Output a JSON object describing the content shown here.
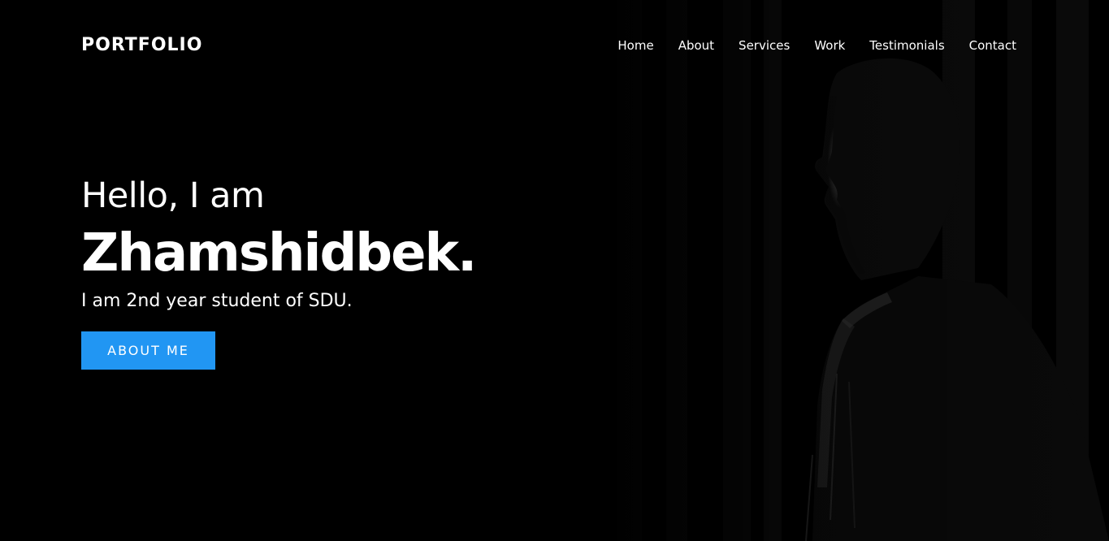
{
  "navbar": {
    "logo": "PORTFOLIO",
    "items": [
      {
        "label": "Home"
      },
      {
        "label": "About"
      },
      {
        "label": "Services"
      },
      {
        "label": "Work"
      },
      {
        "label": "Testimonials"
      },
      {
        "label": "Contact"
      }
    ]
  },
  "hero": {
    "greeting": "Hello, I am",
    "name": "Zhamshidbek.",
    "tagline": "I am 2nd year student of SDU.",
    "button_label": "ABOUT ME",
    "button_color": "#2196f3",
    "photo": "portrait-silhouette-man-profile"
  },
  "colors": {
    "background": "#000000",
    "text": "#ffffff",
    "accent": "#2196f3"
  }
}
